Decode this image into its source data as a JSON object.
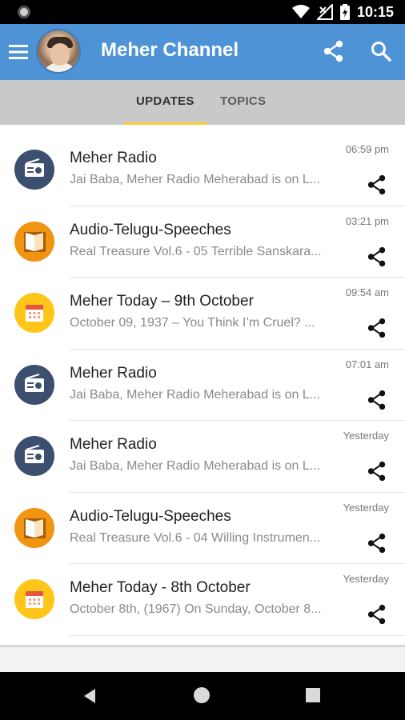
{
  "status_bar": {
    "time": "10:15",
    "icons": [
      "camera-dot-icon",
      "wifi-icon",
      "no-signal-icon",
      "battery-icon"
    ]
  },
  "app_bar": {
    "title": "Meher Channel",
    "background_color": "#4e93d6",
    "icons": [
      "menu-icon",
      "avatar",
      "share-icon",
      "search-icon"
    ]
  },
  "tabs": [
    {
      "label": "UPDATES",
      "selected": true
    },
    {
      "label": "TOPICS",
      "selected": false
    }
  ],
  "tab_indicator_color": "#ffcc33",
  "updates": [
    {
      "icon": "radio-icon",
      "icon_color": "#3c4f6e",
      "title": "Meher Radio",
      "subtitle": "Jai Baba, Meher Radio Meherabad is on L...",
      "time": "06:59 pm"
    },
    {
      "icon": "book-icon",
      "icon_color": "#f09512",
      "title": "Audio-Telugu-Speeches",
      "subtitle": "Real Treasure Vol.6 - 05 Terrible Sanskara...",
      "time": "03:21 pm"
    },
    {
      "icon": "calendar-icon",
      "icon_color": "#ffc619",
      "title": "Meher Today – 9th October",
      "subtitle": "October 09, 1937 – You Think I’m Cruel? ...",
      "time": "09:54 am"
    },
    {
      "icon": "radio-icon",
      "icon_color": "#3c4f6e",
      "title": "Meher Radio",
      "subtitle": "Jai Baba, Meher Radio Meherabad is on L...",
      "time": "07:01 am"
    },
    {
      "icon": "radio-icon",
      "icon_color": "#3c4f6e",
      "title": "Meher Radio",
      "subtitle": "Jai Baba, Meher Radio Meherabad is on L...",
      "time": "Yesterday"
    },
    {
      "icon": "book-icon",
      "icon_color": "#f09512",
      "title": "Audio-Telugu-Speeches",
      "subtitle": "Real Treasure Vol.6 - 04 Willing Instrumen...",
      "time": "Yesterday"
    },
    {
      "icon": "calendar-icon",
      "icon_color": "#ffc619",
      "title": "Meher Today - 8th October",
      "subtitle": "October 8th, (1967) On Sunday, October 8...",
      "time": "Yesterday"
    }
  ],
  "nav_bar": {
    "icons": [
      "back-icon",
      "home-icon",
      "recent-apps-icon"
    ]
  }
}
